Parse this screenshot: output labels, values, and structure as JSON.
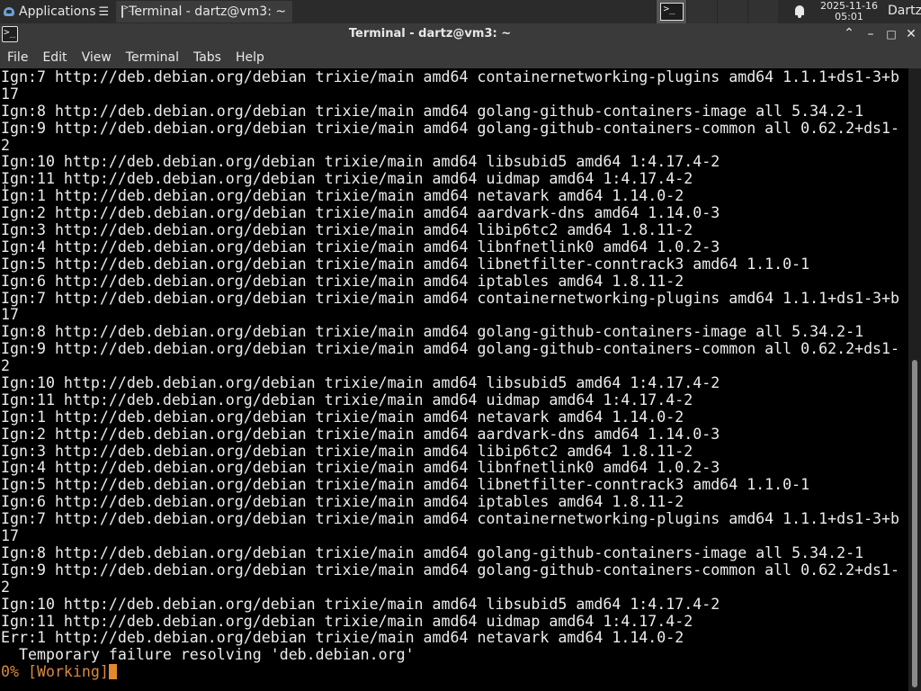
{
  "panel": {
    "applications_label": "Applications",
    "taskbar_item": "Terminal - dartz@vm3: ~",
    "clock_date": "2025-11-16",
    "clock_time": "05:01",
    "user": "Dartz"
  },
  "window": {
    "title": "Terminal - dartz@vm3: ~",
    "minimize_glyph": "–",
    "maximize_glyph": "□",
    "close_glyph": "✕",
    "restore_glyph": "⌃"
  },
  "menu": [
    "File",
    "Edit",
    "View",
    "Terminal",
    "Tabs",
    "Help"
  ],
  "terminal": {
    "lines": [
      "Ign:7 http://deb.debian.org/debian trixie/main amd64 containernetworking-plugins amd64 1.1.1+ds1-3+b",
      "17",
      "Ign:8 http://deb.debian.org/debian trixie/main amd64 golang-github-containers-image all 5.34.2-1",
      "Ign:9 http://deb.debian.org/debian trixie/main amd64 golang-github-containers-common all 0.62.2+ds1-",
      "2",
      "Ign:10 http://deb.debian.org/debian trixie/main amd64 libsubid5 amd64 1:4.17.4-2",
      "Ign:11 http://deb.debian.org/debian trixie/main amd64 uidmap amd64 1:4.17.4-2",
      "Ign:1 http://deb.debian.org/debian trixie/main amd64 netavark amd64 1.14.0-2",
      "Ign:2 http://deb.debian.org/debian trixie/main amd64 aardvark-dns amd64 1.14.0-3",
      "Ign:3 http://deb.debian.org/debian trixie/main amd64 libip6tc2 amd64 1.8.11-2",
      "Ign:4 http://deb.debian.org/debian trixie/main amd64 libnfnetlink0 amd64 1.0.2-3",
      "Ign:5 http://deb.debian.org/debian trixie/main amd64 libnetfilter-conntrack3 amd64 1.1.0-1",
      "Ign:6 http://deb.debian.org/debian trixie/main amd64 iptables amd64 1.8.11-2",
      "Ign:7 http://deb.debian.org/debian trixie/main amd64 containernetworking-plugins amd64 1.1.1+ds1-3+b",
      "17",
      "Ign:8 http://deb.debian.org/debian trixie/main amd64 golang-github-containers-image all 5.34.2-1",
      "Ign:9 http://deb.debian.org/debian trixie/main amd64 golang-github-containers-common all 0.62.2+ds1-",
      "2",
      "Ign:10 http://deb.debian.org/debian trixie/main amd64 libsubid5 amd64 1:4.17.4-2",
      "Ign:11 http://deb.debian.org/debian trixie/main amd64 uidmap amd64 1:4.17.4-2",
      "Ign:1 http://deb.debian.org/debian trixie/main amd64 netavark amd64 1.14.0-2",
      "Ign:2 http://deb.debian.org/debian trixie/main amd64 aardvark-dns amd64 1.14.0-3",
      "Ign:3 http://deb.debian.org/debian trixie/main amd64 libip6tc2 amd64 1.8.11-2",
      "Ign:4 http://deb.debian.org/debian trixie/main amd64 libnfnetlink0 amd64 1.0.2-3",
      "Ign:5 http://deb.debian.org/debian trixie/main amd64 libnetfilter-conntrack3 amd64 1.1.0-1",
      "Ign:6 http://deb.debian.org/debian trixie/main amd64 iptables amd64 1.8.11-2",
      "Ign:7 http://deb.debian.org/debian trixie/main amd64 containernetworking-plugins amd64 1.1.1+ds1-3+b",
      "17",
      "Ign:8 http://deb.debian.org/debian trixie/main amd64 golang-github-containers-image all 5.34.2-1",
      "Ign:9 http://deb.debian.org/debian trixie/main amd64 golang-github-containers-common all 0.62.2+ds1-",
      "2",
      "Ign:10 http://deb.debian.org/debian trixie/main amd64 libsubid5 amd64 1:4.17.4-2",
      "Ign:11 http://deb.debian.org/debian trixie/main amd64 uidmap amd64 1:4.17.4-2",
      "Err:1 http://deb.debian.org/debian trixie/main amd64 netavark amd64 1.14.0-2",
      "  Temporary failure resolving 'deb.debian.org'"
    ],
    "status_line": "0% [Working]"
  },
  "colors": {
    "terminal_bg": "#000000",
    "terminal_fg": "#ececec",
    "status_orange": "#d9893e",
    "panel_bg": "#2b2b2b",
    "titlebar_bg": "#3a3a3a"
  }
}
